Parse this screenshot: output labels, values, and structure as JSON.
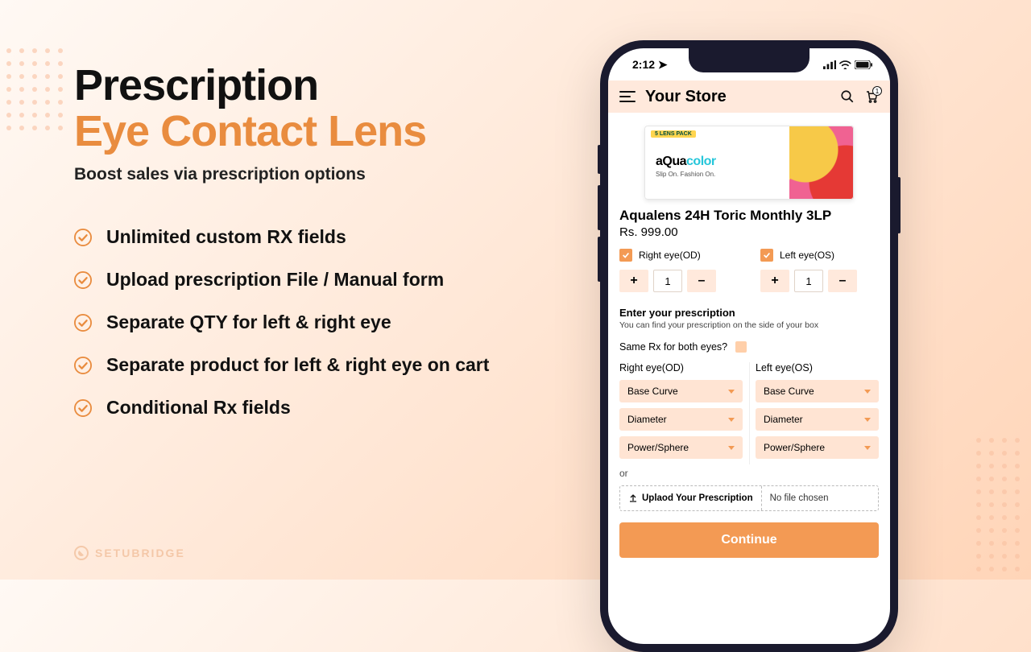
{
  "hero": {
    "title_line1": "Prescription",
    "title_line2": "Eye Contact Lens",
    "subtitle": "Boost sales via prescription options"
  },
  "features": [
    "Unlimited custom RX fields",
    "Upload prescription File / Manual form",
    "Separate QTY for left & right eye",
    "Separate product for left & right eye on cart",
    "Conditional Rx fields"
  ],
  "brand": {
    "name": "SETUBRIDGE"
  },
  "phone": {
    "status_time": "2:12",
    "store_title": "Your Store",
    "cart_count": "1",
    "product_badge": "5 LENS PACK",
    "product_img_brand_a": "aQua",
    "product_img_brand_b": "color",
    "product_img_tag": "Slip On. Fashion On.",
    "product_title": "Aqualens 24H Toric Monthly 3LP",
    "product_price": "Rs. 999.00",
    "right_eye_label": "Right eye(OD)",
    "left_eye_label": "Left eye(OS)",
    "qty_right": "1",
    "qty_left": "1",
    "rx_title": "Enter your prescription",
    "rx_sub": "You can find your prescription on the side of your box",
    "same_rx_label": "Same Rx for both eyes?",
    "right_col_h": "Right eye(OD)",
    "left_col_h": "Left eye(OS)",
    "selects": {
      "base_curve": "Base Curve",
      "diameter": "Diameter",
      "power": "Power/Sphere"
    },
    "or_label": "or",
    "upload_label": "Uplaod Your Prescription",
    "no_file": "No file chosen",
    "continue": "Continue"
  }
}
